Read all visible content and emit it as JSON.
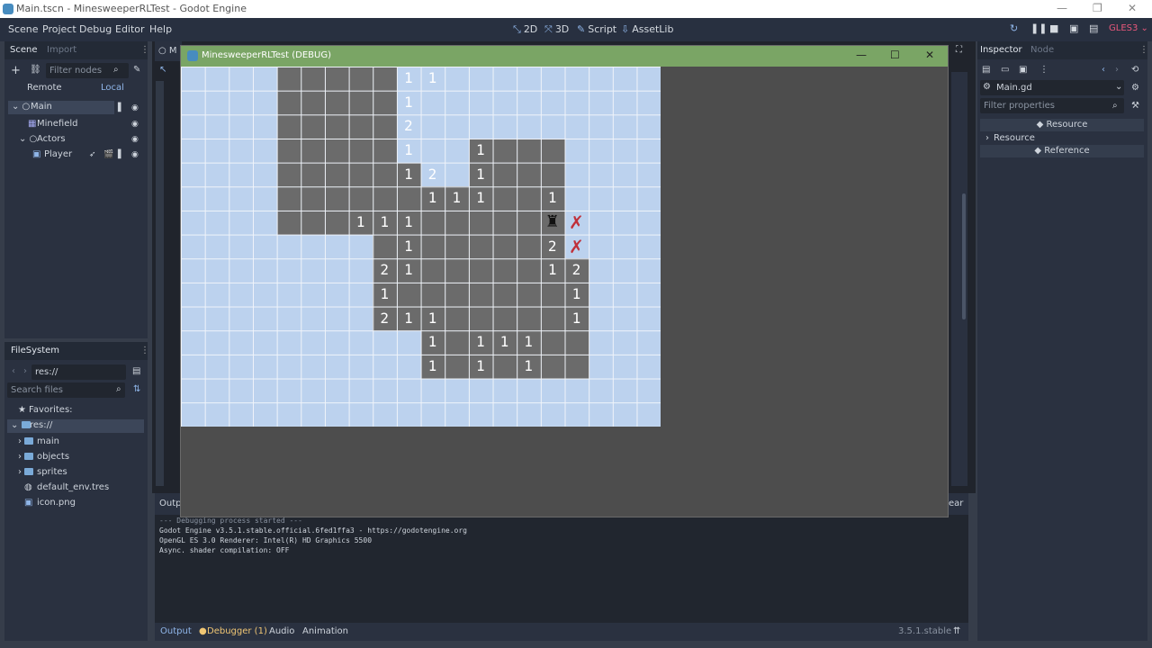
{
  "window": {
    "title": "Main.tscn - MinesweeperRLTest - Godot Engine"
  },
  "menu": [
    "Scene",
    "Project",
    "Debug",
    "Editor",
    "Help"
  ],
  "workspaces": [
    "2D",
    "3D",
    "Script",
    "AssetLib"
  ],
  "renderer": "GLES3",
  "scene_dock": {
    "tabs": [
      "Scene",
      "Import"
    ],
    "filter_placeholder": "Filter nodes",
    "remote": "Remote",
    "local": "Local",
    "tree": [
      "Main",
      "Minefield",
      "Actors",
      "Player"
    ]
  },
  "filesystem": {
    "title": "FileSystem",
    "path": "res://",
    "search_placeholder": "Search files",
    "favorites": "Favorites:",
    "items": [
      "res://",
      "main",
      "objects",
      "sprites",
      "default_env.tres",
      "icon.png"
    ]
  },
  "game_window": {
    "title": "MinesweeperRLTest (DEBUG)"
  },
  "board": {
    "cols": 20,
    "rows": 15,
    "revealed": [
      [
        4,
        0
      ],
      [
        5,
        0
      ],
      [
        6,
        0
      ],
      [
        7,
        0
      ],
      [
        8,
        0
      ],
      [
        4,
        1
      ],
      [
        5,
        1
      ],
      [
        6,
        1
      ],
      [
        7,
        1
      ],
      [
        8,
        1
      ],
      [
        4,
        2
      ],
      [
        5,
        2
      ],
      [
        6,
        2
      ],
      [
        7,
        2
      ],
      [
        8,
        2
      ],
      [
        4,
        3
      ],
      [
        5,
        3
      ],
      [
        6,
        3
      ],
      [
        7,
        3
      ],
      [
        8,
        3
      ],
      [
        12,
        3
      ],
      [
        13,
        3
      ],
      [
        14,
        3
      ],
      [
        15,
        3
      ],
      [
        4,
        4
      ],
      [
        5,
        4
      ],
      [
        6,
        4
      ],
      [
        7,
        4
      ],
      [
        8,
        4
      ],
      [
        9,
        4
      ],
      [
        12,
        4
      ],
      [
        13,
        4
      ],
      [
        14,
        4
      ],
      [
        15,
        4
      ],
      [
        4,
        5
      ],
      [
        5,
        5
      ],
      [
        6,
        5
      ],
      [
        7,
        5
      ],
      [
        8,
        5
      ],
      [
        9,
        5
      ],
      [
        10,
        5
      ],
      [
        11,
        5
      ],
      [
        12,
        5
      ],
      [
        13,
        5
      ],
      [
        14,
        5
      ],
      [
        15,
        5
      ],
      [
        4,
        6
      ],
      [
        5,
        6
      ],
      [
        6,
        6
      ],
      [
        7,
        6
      ],
      [
        8,
        6
      ],
      [
        9,
        6
      ],
      [
        10,
        6
      ],
      [
        11,
        6
      ],
      [
        12,
        6
      ],
      [
        13,
        6
      ],
      [
        14,
        6
      ],
      [
        15,
        6
      ],
      [
        8,
        7
      ],
      [
        9,
        7
      ],
      [
        10,
        7
      ],
      [
        11,
        7
      ],
      [
        12,
        7
      ],
      [
        13,
        7
      ],
      [
        14,
        7
      ],
      [
        15,
        7
      ],
      [
        8,
        8
      ],
      [
        9,
        8
      ],
      [
        10,
        8
      ],
      [
        11,
        8
      ],
      [
        12,
        8
      ],
      [
        13,
        8
      ],
      [
        14,
        8
      ],
      [
        15,
        8
      ],
      [
        16,
        8
      ],
      [
        8,
        9
      ],
      [
        9,
        9
      ],
      [
        10,
        9
      ],
      [
        11,
        9
      ],
      [
        12,
        9
      ],
      [
        13,
        9
      ],
      [
        14,
        9
      ],
      [
        15,
        9
      ],
      [
        16,
        9
      ],
      [
        8,
        10
      ],
      [
        9,
        10
      ],
      [
        10,
        10
      ],
      [
        11,
        10
      ],
      [
        12,
        10
      ],
      [
        13,
        10
      ],
      [
        14,
        10
      ],
      [
        15,
        10
      ],
      [
        16,
        10
      ],
      [
        10,
        11
      ],
      [
        11,
        11
      ],
      [
        12,
        11
      ],
      [
        13,
        11
      ],
      [
        14,
        11
      ],
      [
        15,
        11
      ],
      [
        16,
        11
      ],
      [
        10,
        12
      ],
      [
        11,
        12
      ],
      [
        12,
        12
      ],
      [
        13,
        12
      ],
      [
        14,
        12
      ],
      [
        15,
        12
      ],
      [
        16,
        12
      ]
    ],
    "numbers": [
      {
        "c": 9,
        "r": 0,
        "v": "1"
      },
      {
        "c": 10,
        "r": 0,
        "v": "1"
      },
      {
        "c": 9,
        "r": 1,
        "v": "1"
      },
      {
        "c": 9,
        "r": 2,
        "v": "2"
      },
      {
        "c": 9,
        "r": 3,
        "v": "1"
      },
      {
        "c": 12,
        "r": 3,
        "v": "1"
      },
      {
        "c": 9,
        "r": 4,
        "v": "1"
      },
      {
        "c": 10,
        "r": 4,
        "v": "2"
      },
      {
        "c": 12,
        "r": 4,
        "v": "1"
      },
      {
        "c": 10,
        "r": 5,
        "v": "1"
      },
      {
        "c": 11,
        "r": 5,
        "v": "1"
      },
      {
        "c": 12,
        "r": 5,
        "v": "1"
      },
      {
        "c": 15,
        "r": 5,
        "v": "1"
      },
      {
        "c": 7,
        "r": 6,
        "v": "1"
      },
      {
        "c": 8,
        "r": 6,
        "v": "1"
      },
      {
        "c": 9,
        "r": 6,
        "v": "1"
      },
      {
        "c": 9,
        "r": 7,
        "v": "1"
      },
      {
        "c": 15,
        "r": 7,
        "v": "2"
      },
      {
        "c": 8,
        "r": 8,
        "v": "2"
      },
      {
        "c": 9,
        "r": 8,
        "v": "1"
      },
      {
        "c": 15,
        "r": 8,
        "v": "1"
      },
      {
        "c": 16,
        "r": 8,
        "v": "2"
      },
      {
        "c": 8,
        "r": 9,
        "v": "1"
      },
      {
        "c": 16,
        "r": 9,
        "v": "1"
      },
      {
        "c": 8,
        "r": 10,
        "v": "2"
      },
      {
        "c": 9,
        "r": 10,
        "v": "1"
      },
      {
        "c": 10,
        "r": 10,
        "v": "1"
      },
      {
        "c": 16,
        "r": 10,
        "v": "1"
      },
      {
        "c": 10,
        "r": 11,
        "v": "1"
      },
      {
        "c": 12,
        "r": 11,
        "v": "1"
      },
      {
        "c": 13,
        "r": 11,
        "v": "1"
      },
      {
        "c": 14,
        "r": 11,
        "v": "1"
      },
      {
        "c": 10,
        "r": 12,
        "v": "1"
      },
      {
        "c": 12,
        "r": 12,
        "v": "1"
      },
      {
        "c": 14,
        "r": 12,
        "v": "1"
      }
    ],
    "flags": [
      {
        "c": 16,
        "r": 6
      },
      {
        "c": 16,
        "r": 7
      }
    ],
    "player": {
      "c": 15,
      "r": 6
    },
    "colors": {
      "hidden": "#bcd2ee",
      "revealed": "#6b6b6b",
      "flag": "#c0303a"
    }
  },
  "output": {
    "tab": "Outp",
    "lines": [
      "--- Debugging process started ---",
      "Godot Engine v3.5.1.stable.official.6fed1ffa3 - https://godotengine.org",
      "OpenGL ES 3.0 Renderer: Intel(R) HD Graphics 5500",
      "Async. shader compilation: OFF"
    ],
    "clear": "ear"
  },
  "bottom_tabs": [
    "Output",
    "Debugger (1)",
    "Audio",
    "Animation"
  ],
  "version": "3.5.1.stable",
  "inspector": {
    "tabs": [
      "Inspector",
      "Node"
    ],
    "resource_name": "Main.gd",
    "filter_placeholder": "Filter properties",
    "sections": [
      "Resource",
      "Resource",
      "Reference"
    ]
  }
}
